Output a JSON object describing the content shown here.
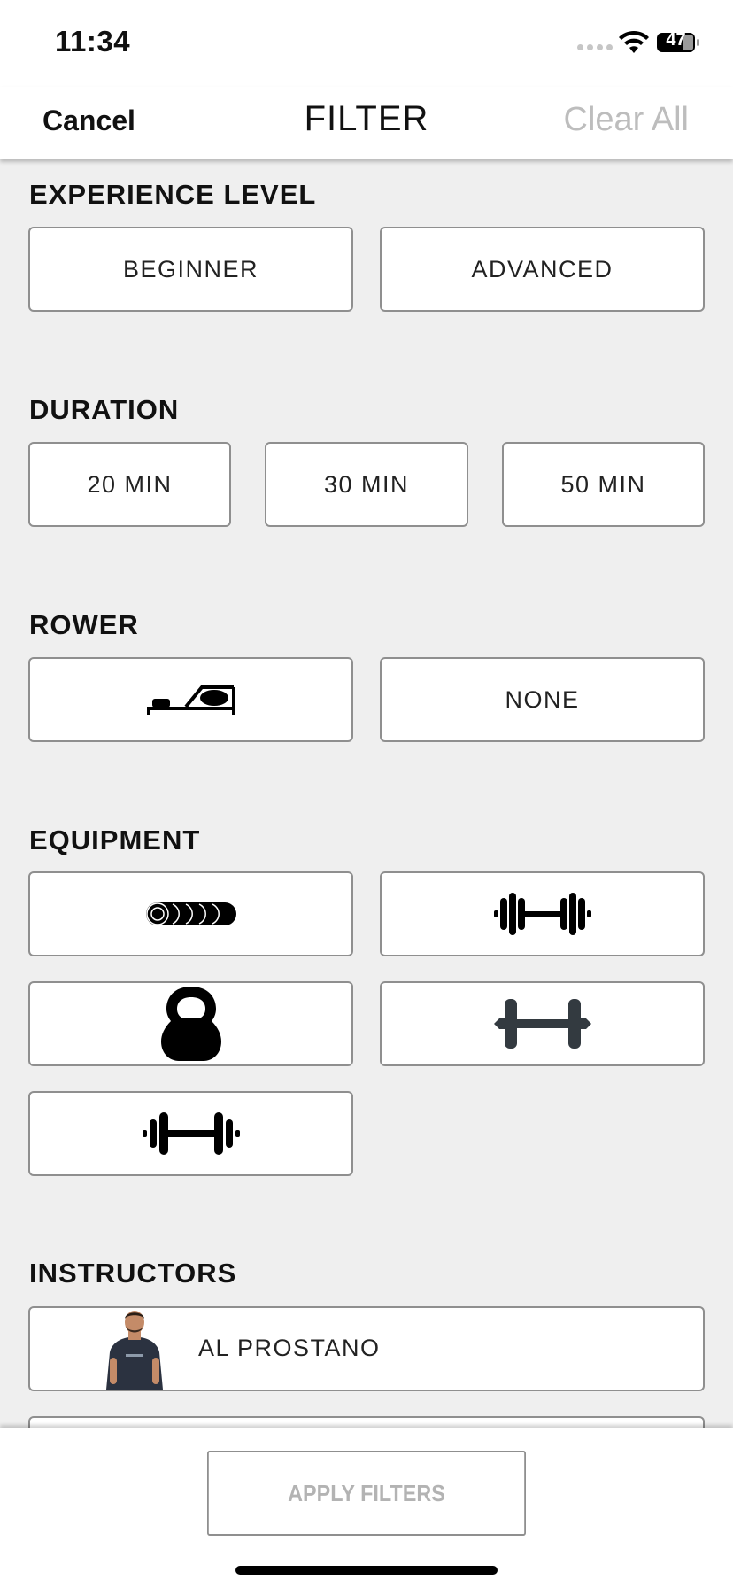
{
  "status_bar": {
    "time": "11:34",
    "battery": "47"
  },
  "header": {
    "cancel": "Cancel",
    "title": "FILTER",
    "clear_all": "Clear All"
  },
  "sections": {
    "experience": {
      "title": "EXPERIENCE LEVEL",
      "options": [
        "BEGINNER",
        "ADVANCED"
      ]
    },
    "duration": {
      "title": "DURATION",
      "options": [
        "20 MIN",
        "30 MIN",
        "50 MIN"
      ]
    },
    "rower": {
      "title": "ROWER",
      "options": [
        "rower-icon",
        "NONE"
      ]
    },
    "equipment": {
      "title": "EQUIPMENT",
      "options": [
        "foam-roller-icon",
        "barbell-icon",
        "kettlebell-icon",
        "dumbbell-icon",
        "weights-icon"
      ]
    },
    "instructors": {
      "title": "INSTRUCTORS",
      "items": [
        "AL PROSTANO"
      ]
    }
  },
  "footer": {
    "apply_label": "APPLY FILTERS"
  },
  "colors": {
    "background": "#efefef",
    "border": "#8f8f8f",
    "muted_text": "#bdbdbd",
    "card": "#ffffff"
  }
}
